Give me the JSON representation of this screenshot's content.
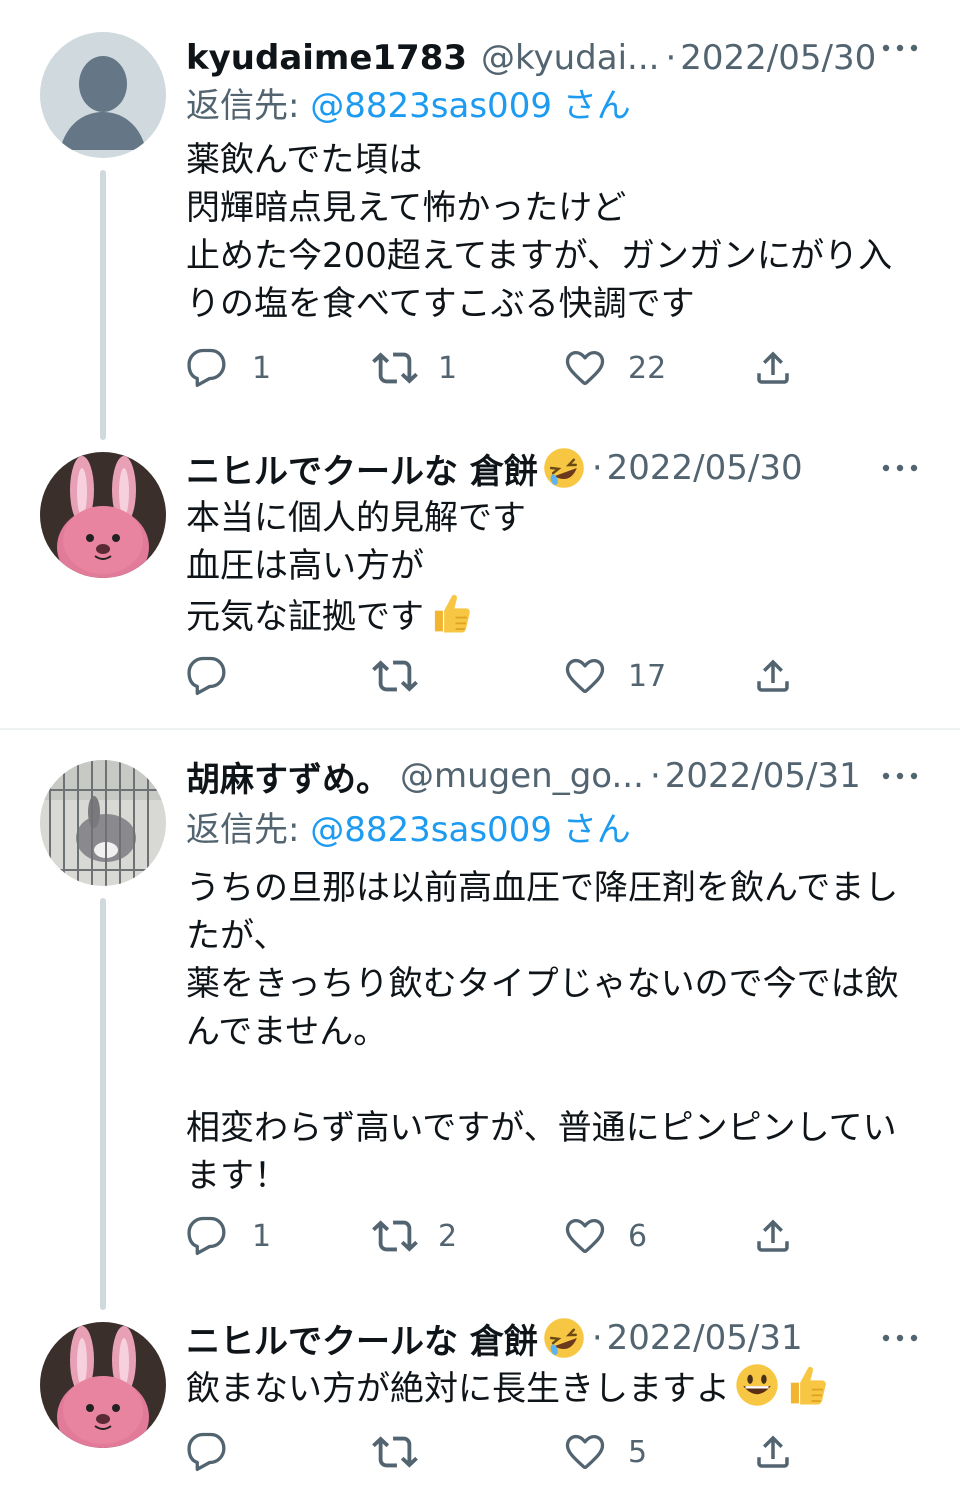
{
  "tweets": [
    {
      "name": "kyudaime1783",
      "handle": "@kyudai...",
      "separator": "·",
      "date": "2022/05/30",
      "reply_prefix": "返信先: ",
      "reply_mention": "@8823sas009",
      "reply_suffix": " さん",
      "body": "薬飲んでた頃は\n閃輝暗点見えて怖かったけど\n止めた今200超えてますが、ガンガンにがり入りの塩を食べてすこぶる快調です",
      "replies": "1",
      "retweets": "1",
      "likes": "22",
      "avatar_icon": "default-avatar-icon"
    },
    {
      "name": "ニヒルでクールな 倉餅",
      "name_emoji_icon": "rolling-laughing-emoji-icon",
      "separator": "·",
      "date": "2022/05/30",
      "body": "本当に個人的見解です\n血圧は高い方が\n元気な証拠です",
      "body_emoji_icon": "thumbs-up-emoji-icon",
      "replies": "",
      "retweets": "",
      "likes": "17",
      "avatar_icon": "pink-rabbit-avatar-icon"
    },
    {
      "name": "胡麻すずめ。",
      "handle": "@mugen_go...",
      "separator": "·",
      "date": "2022/05/31",
      "reply_prefix": "返信先: ",
      "reply_mention": "@8823sas009",
      "reply_suffix": " さん",
      "body": "うちの旦那は以前高血圧で降圧剤を飲んでましたが、\n薬をきっちり飲むタイプじゃないので今では飲んでません。\n\n相変わらず高いですが、普通にピンピンしています！",
      "replies": "1",
      "retweets": "2",
      "likes": "6",
      "avatar_icon": "rabbit-cage-photo-avatar"
    },
    {
      "name": "ニヒルでクールな 倉餅",
      "name_emoji_icon": "rolling-laughing-emoji-icon",
      "separator": "·",
      "date": "2022/05/31",
      "body": "飲まない方が絶対に長生きしますよ",
      "body_emoji_icons": [
        "grinning-face-emoji-icon",
        "thumbs-up-emoji-icon"
      ],
      "replies": "",
      "retweets": "",
      "likes": "5",
      "avatar_icon": "pink-rabbit-avatar-icon"
    }
  ],
  "colors": {
    "text": "#0f1419",
    "secondary": "#536471",
    "link": "#1d9bf0",
    "thread_line": "#cfd9de",
    "divider": "#eff3f4",
    "rabbit_pink": "#e27a9a",
    "avatar_gray": "#cfd9de"
  }
}
